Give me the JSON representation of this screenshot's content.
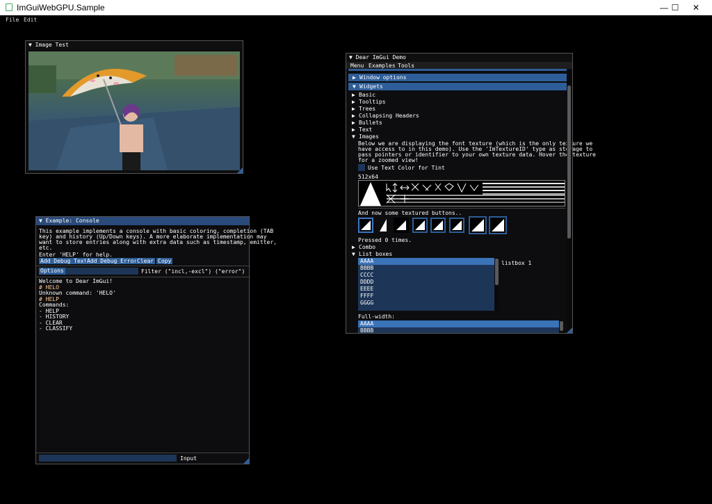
{
  "window": {
    "title": "ImGuiWebGPU.Sample",
    "minimize": "—",
    "maximize": "☐",
    "close": "✕"
  },
  "menubar": {
    "file": "File",
    "edit": "Edit"
  },
  "image_test": {
    "title": "▼ Image Test"
  },
  "demo": {
    "title": "▼ Dear ImGui Demo",
    "menu": [
      "Menu",
      "Examples",
      "Tools"
    ],
    "window_options": "Window options",
    "widgets": "Widgets",
    "items": [
      "Basic",
      "Tooltips",
      "Trees",
      "Collapsing Headers",
      "Bullets",
      "Text"
    ],
    "images_label": "Images",
    "images_desc": [
      "Below we are displaying the font texture (which is the only texture we",
      "have access to in this demo). Use the 'ImTextureID' type as storage to",
      "pass pointers or identifier to your own texture data. Hover the texture",
      "for a zoomed view!"
    ],
    "tint_label": "Use Text Color for Tint",
    "texture_size": "512x64",
    "textured_buttons": "And now some textured buttons..",
    "pressed": "Pressed 0 times.",
    "combo": "Combo",
    "list_boxes": "List boxes",
    "listbox_items": [
      "AAAA",
      "BBBB",
      "CCCC",
      "DDDD",
      "EEEE",
      "FFFF",
      "GGGG"
    ],
    "listbox_label": "listbox 1",
    "full_width": "Full-width:",
    "full_items": [
      "AAAA",
      "BBBB"
    ]
  },
  "console": {
    "title": "▼ Example: Console",
    "desc": [
      "This example implements a console with basic coloring, completion (TAB",
      "key) and history (Up/Down keys). A more elaborate implementation may",
      "want to store entries along with extra data such as timestamp, emitter,",
      "etc."
    ],
    "help": "Enter 'HELP' for help.",
    "buttons": [
      "Add Debug Text",
      "Add Debug Error",
      "Clear",
      "Copy"
    ],
    "options": "Options",
    "filter": "Filter (\"incl,-excl\") (\"error\")",
    "log": [
      {
        "text": "Welcome to Dear ImGui!",
        "color": "#ffffff"
      },
      {
        "text": "# HELO",
        "color": "#ffcc99"
      },
      {
        "text": "Unknown command: 'HELO'",
        "color": "#ffffff"
      },
      {
        "text": "# HELP",
        "color": "#ffcc99"
      },
      {
        "text": "Commands:",
        "color": "#ffffff"
      },
      {
        "text": "- HELP",
        "color": "#ffffff"
      },
      {
        "text": "- HISTORY",
        "color": "#ffffff"
      },
      {
        "text": "- CLEAR",
        "color": "#ffffff"
      },
      {
        "text": "- CLASSIFY",
        "color": "#ffffff"
      }
    ],
    "input_label": "Input"
  }
}
